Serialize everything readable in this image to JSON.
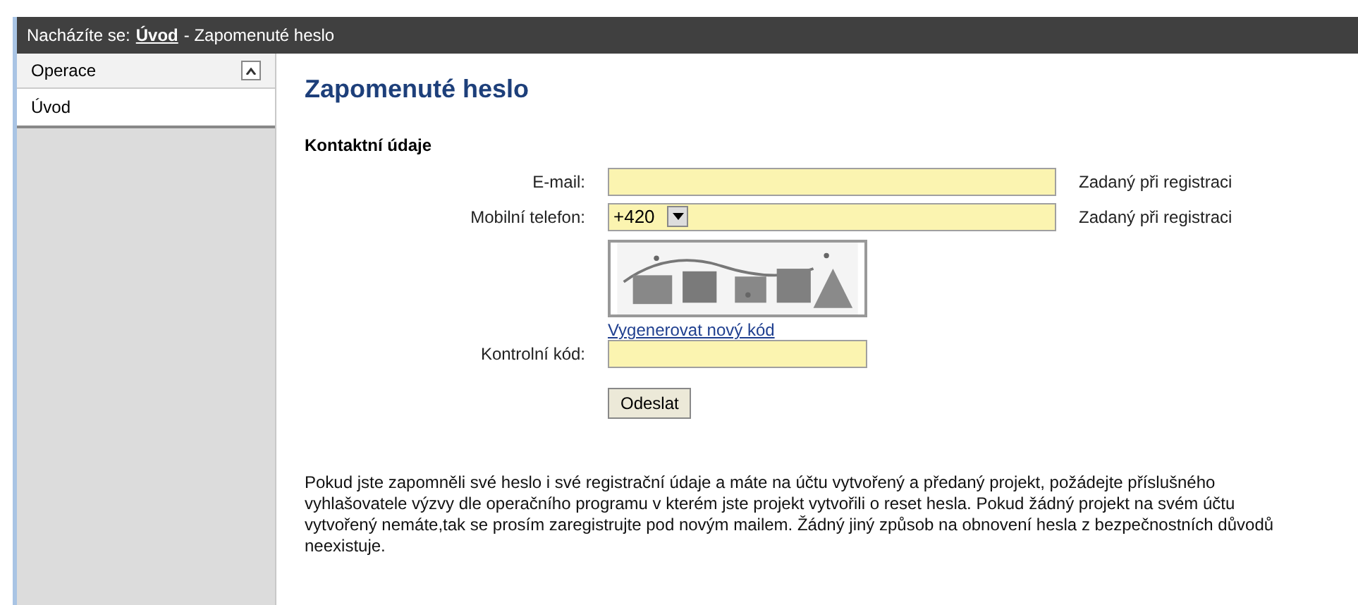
{
  "breadcrumb": {
    "label": "Nacházíte se:",
    "link": "Úvod",
    "current": "- Zapomenuté heslo"
  },
  "sidebar": {
    "section": {
      "title": "Operace",
      "expanded": true
    },
    "items": [
      {
        "label": "Úvod",
        "selected": false
      }
    ]
  },
  "page_title": "Zapomenuté heslo",
  "section_title": "Kontaktní údaje",
  "fields": [
    {
      "kind": "text",
      "label": "E-mail:",
      "hint": "Zadaný při registraci"
    },
    {
      "kind": "phone",
      "label": "Mobilní telefon:",
      "prefix": "+420",
      "hint": "Zadaný při registraci"
    }
  ],
  "captcha": {
    "link": "Vygenerovat nový kód",
    "label": "Kontrolní kód:"
  },
  "submit": "Odeslat",
  "note": "Pokud jste zapomněli své heslo i své registrační údaje a máte na účtu vytvořený a předaný projekt, požádejte příslušného vyhlašovatele výzvy dle operačního programu v kterém jste projekt vytvořili o reset hesla. Pokud žádný projekt na svém účtu vytvořený nemáte,tak se prosím zaregistrujte pod novým mailem. Žádný jiný způsob na obnovení hesla z bezpečnostních důvodů neexistuje."
}
